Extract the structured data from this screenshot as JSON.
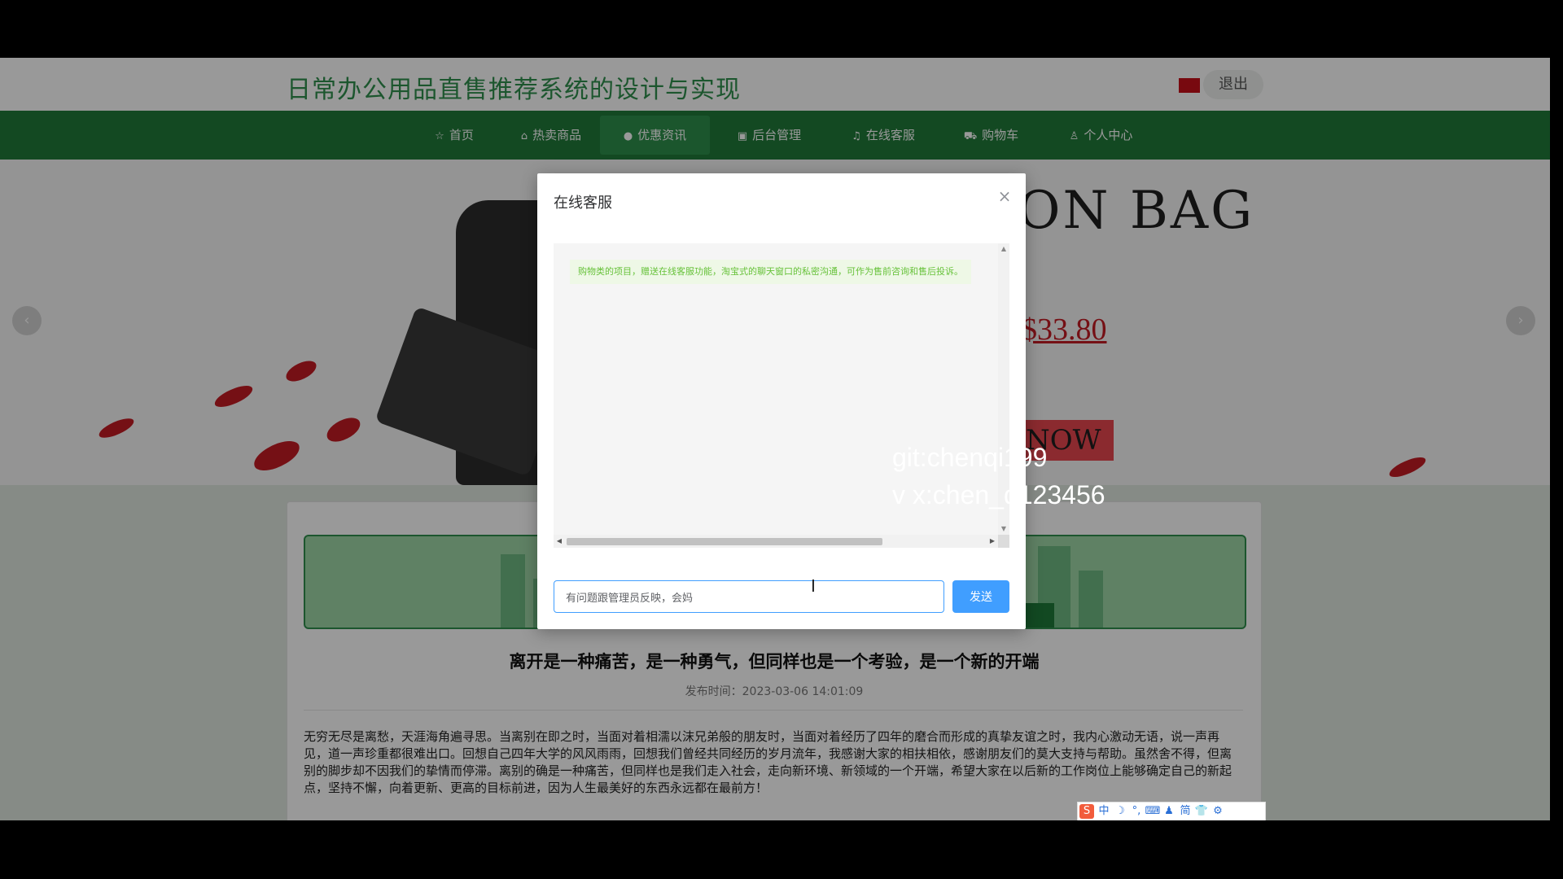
{
  "header": {
    "site_title": "日常办公用品直售推荐系统的设计与实现",
    "logout_label": "退出"
  },
  "nav": {
    "items": [
      {
        "label": "首页",
        "icon": "star-icon"
      },
      {
        "label": "热卖商品",
        "icon": "bag-icon"
      },
      {
        "label": "优惠资讯",
        "icon": "info-icon"
      },
      {
        "label": "后台管理",
        "icon": "calendar-icon"
      },
      {
        "label": "在线客服",
        "icon": "headset-icon"
      },
      {
        "label": "购物车",
        "icon": "cart-icon"
      },
      {
        "label": "个人中心",
        "icon": "user-icon"
      }
    ],
    "active_index": 2
  },
  "banner": {
    "title": "ON BAG",
    "price": "$33.80",
    "button_label": "NOW"
  },
  "article": {
    "title": "离开是一种痛苦，是一种勇气，但同样也是一个考验，是一个新的开端",
    "meta": "发布时间：2023-03-06 14:01:09",
    "body": "无穷无尽是离愁，天涯海角遍寻思。当离别在即之时，当面对着相濡以沫兄弟般的朋友时，当面对着经历了四年的磨合而形成的真挚友谊之时，我内心激动无语，说一声再见，道一声珍重都很难出口。回想自己四年大学的风风雨雨，回想我们曾经共同经历的岁月流年，我感谢大家的相扶相依，感谢朋友们的莫大支持与帮助。虽然舍不得，但离别的脚步却不因我们的挚情而停滞。离别的确是一种痛苦，但同样也是我们走入社会，走向新环境、新领域的一个开端，希望大家在以后新的工作岗位上能够确定自己的新起点，坚持不懈，向着更新、更高的目标前进，因为人生最美好的东西永远都在最前方！"
  },
  "chat_modal": {
    "title": "在线客服",
    "close_symbol": "×",
    "messages": [
      {
        "text": "购物类的项目，赠送在线客服功能，淘宝式的聊天窗口的私密沟通，可作为售前咨询和售后投诉。"
      }
    ],
    "input_value": "有问题跟管理员反映，会妈",
    "send_label": "发送"
  },
  "watermark": {
    "line1": "git:chenqi199",
    "line2": "v x:chen_q123456"
  },
  "ime_toolbar": {
    "items": [
      "中",
      "☽",
      "°,",
      "⌨",
      "♟",
      "简",
      "👕",
      "⚙"
    ]
  }
}
